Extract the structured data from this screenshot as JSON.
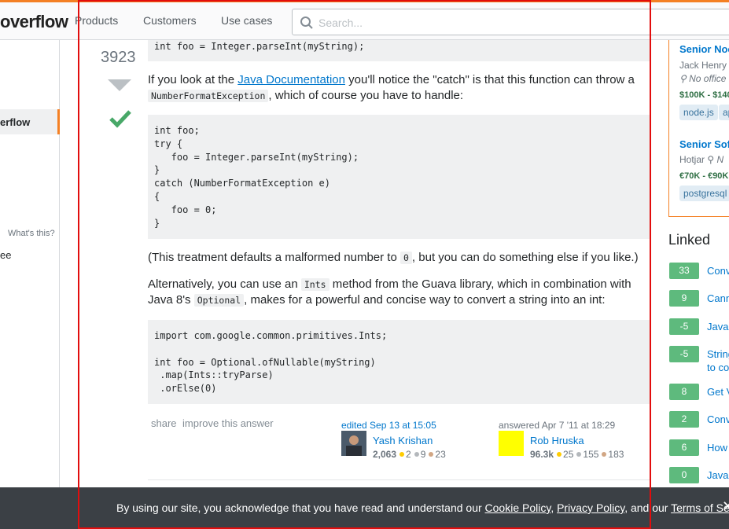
{
  "header": {
    "logo": "overflow",
    "nav": [
      "Products",
      "Customers",
      "Use cases"
    ],
    "search_placeholder": "Search..."
  },
  "leftnav": {
    "active": "erflow",
    "whats_this": "What's this?",
    "item_ee": "ee"
  },
  "answer": {
    "votes": "3923",
    "code1": "int foo = Integer.parseInt(myString);",
    "p1_a": "If you look at the ",
    "p1_link": "Java Documentation",
    "p1_b": " you'll notice the \"catch\" is that this function can throw a",
    "p1_code": "NumberFormatException",
    "p1_c": ", which of course you have to handle:",
    "code2": "int foo;\ntry {\n   foo = Integer.parseInt(myString);\n}\ncatch (NumberFormatException e)\n{\n   foo = 0;\n}",
    "p2_a": "(This treatment defaults a malformed number to ",
    "p2_code": "0",
    "p2_b": ", but you can do something else if you like.)",
    "p3_a": "Alternatively, you can use an ",
    "p3_code1": "Ints",
    "p3_b": " method from the Guava library, which in combination with",
    "p3_c": "Java 8's ",
    "p3_code2": "Optional",
    "p3_d": ", makes for a powerful and concise way to convert a string into an int:",
    "code3": "import com.google.common.primitives.Ints;\n\nint foo = Optional.ofNullable(myString)\n .map(Ints::tryParse)\n .orElse(0)",
    "share": "share",
    "improve": "improve this answer",
    "editor": {
      "when": "edited Sep 13 at 15:05",
      "name": "Yash Krishan",
      "rep": "2,063",
      "gold": "2",
      "silver": "9",
      "bronze": "23"
    },
    "author": {
      "when": "answered Apr 7 '11 at 18:29",
      "name": "Rob Hruska",
      "rep": "96.3k",
      "gold": "25",
      "silver": "155",
      "bronze": "183"
    }
  },
  "jobs": [
    {
      "title": "Senior Noc",
      "company": "Jack Henry",
      "location": "No office",
      "salary": "$100K - $140",
      "tags": [
        "node.js",
        "ap"
      ]
    },
    {
      "title": "Senior Sof",
      "company": "Hotjar",
      "location": "N",
      "salary": "€70K - €90K",
      "tags": [
        "postgresql"
      ]
    }
  ],
  "linked": {
    "heading": "Linked",
    "items": [
      {
        "score": "33",
        "title": "Conv"
      },
      {
        "score": "9",
        "title": "Cann"
      },
      {
        "score": "-5",
        "title": "Java"
      },
      {
        "score": "-5",
        "title": "String",
        "title2": "to co"
      },
      {
        "score": "8",
        "title": "Get V"
      },
      {
        "score": "2",
        "title": "Conv"
      },
      {
        "score": "6",
        "title": "How"
      },
      {
        "score": "0",
        "title": "Java"
      }
    ]
  },
  "cookie": {
    "text_a": "By using our site, you acknowledge that you have read and understand our ",
    "cookie_policy": "Cookie Policy",
    "comma": ", ",
    "privacy_policy": "Privacy Policy",
    "text_b": ", and our ",
    "terms": "Terms of Service",
    "period": ".",
    "close": "✕"
  },
  "colors": {
    "accent": "#f48024",
    "link": "#0077cc",
    "accepted": "#48a868",
    "linked_badge": "#5eba7d",
    "cookie_bg": "#3b4045",
    "highlight_box": "#e20d0d"
  }
}
